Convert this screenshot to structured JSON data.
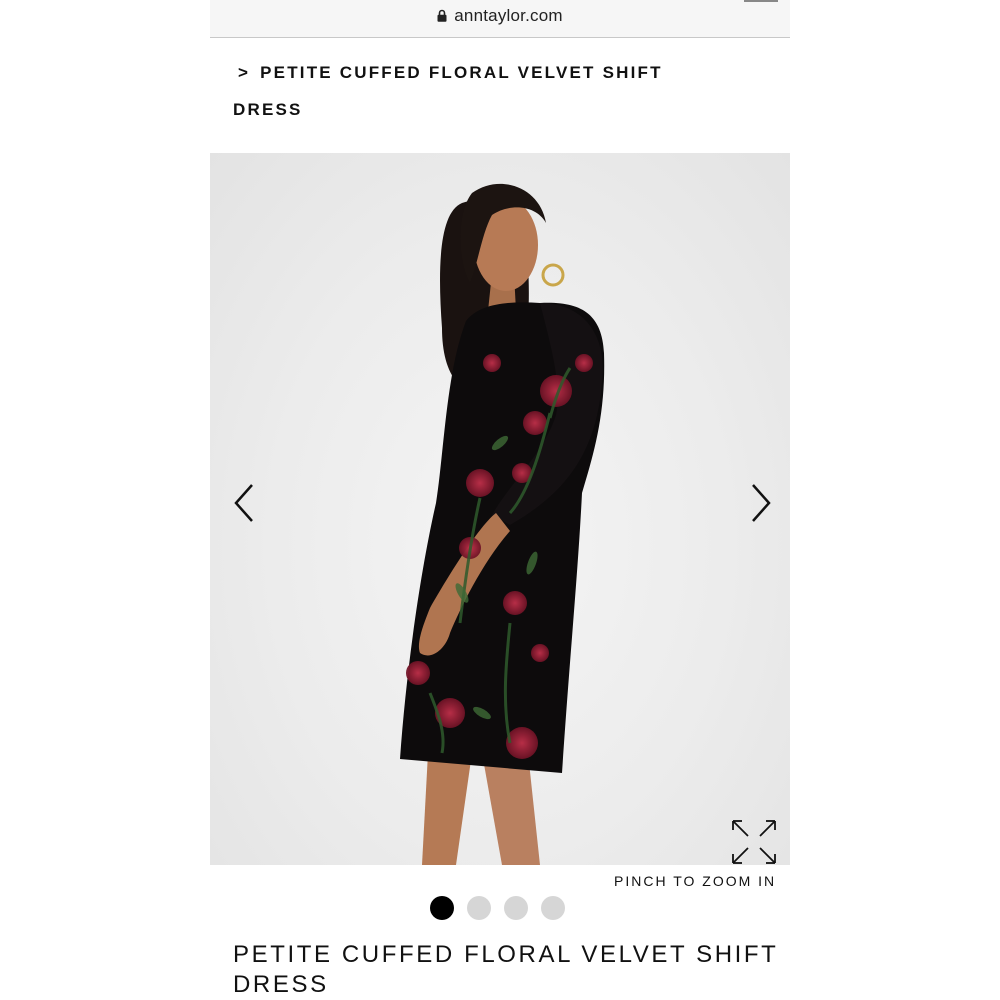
{
  "browser": {
    "url": "anntaylor.com",
    "lock_icon": "lock-icon"
  },
  "breadcrumb": {
    "separator": ">",
    "current": "PETITE CUFFED FLORAL VELVET SHIFT DRESS"
  },
  "gallery": {
    "prev_icon": "chevron-left-icon",
    "next_icon": "chevron-right-icon",
    "expand_icon": "expand-icon",
    "zoom_hint": "PINCH TO ZOOM IN",
    "image_count": 4,
    "active_index": 0
  },
  "product": {
    "title": "PETITE CUFFED FLORAL VELVET SHIFT DRESS"
  }
}
